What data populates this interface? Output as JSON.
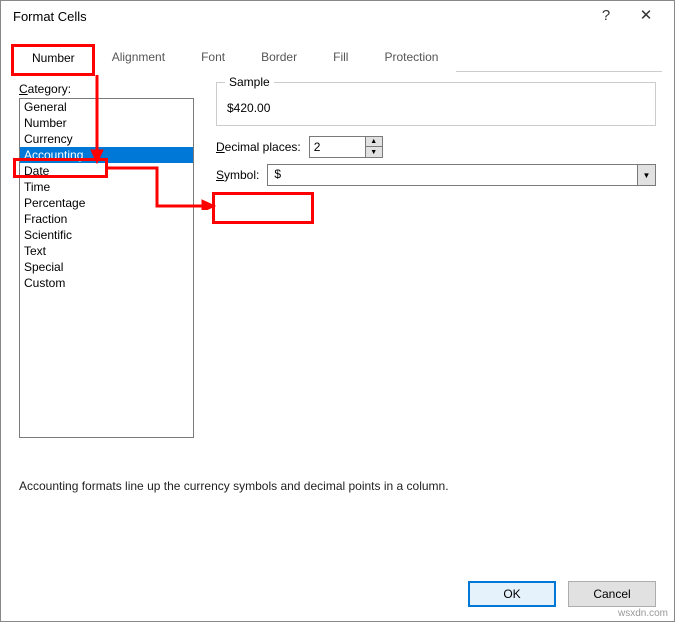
{
  "title": "Format Cells",
  "help_icon": "?",
  "close_icon": "✕",
  "tabs": [
    "Number",
    "Alignment",
    "Font",
    "Border",
    "Fill",
    "Protection"
  ],
  "active_tab": 0,
  "category_label_pre": "C",
  "category_label_rest": "ategory:",
  "categories": [
    "General",
    "Number",
    "Currency",
    "Accounting",
    "Date",
    "Time",
    "Percentage",
    "Fraction",
    "Scientific",
    "Text",
    "Special",
    "Custom"
  ],
  "selected_category": 3,
  "sample": {
    "legend": "Sample",
    "value": "$420.00"
  },
  "decimal": {
    "label_pre": "D",
    "label_rest": "ecimal places:",
    "value": "2"
  },
  "symbol": {
    "label_pre": "S",
    "label_rest": "ymbol:",
    "value": "$"
  },
  "description": "Accounting formats line up the currency symbols and decimal points in a column.",
  "buttons": {
    "ok": "OK",
    "cancel": "Cancel"
  },
  "watermark": "wsxdn.com"
}
